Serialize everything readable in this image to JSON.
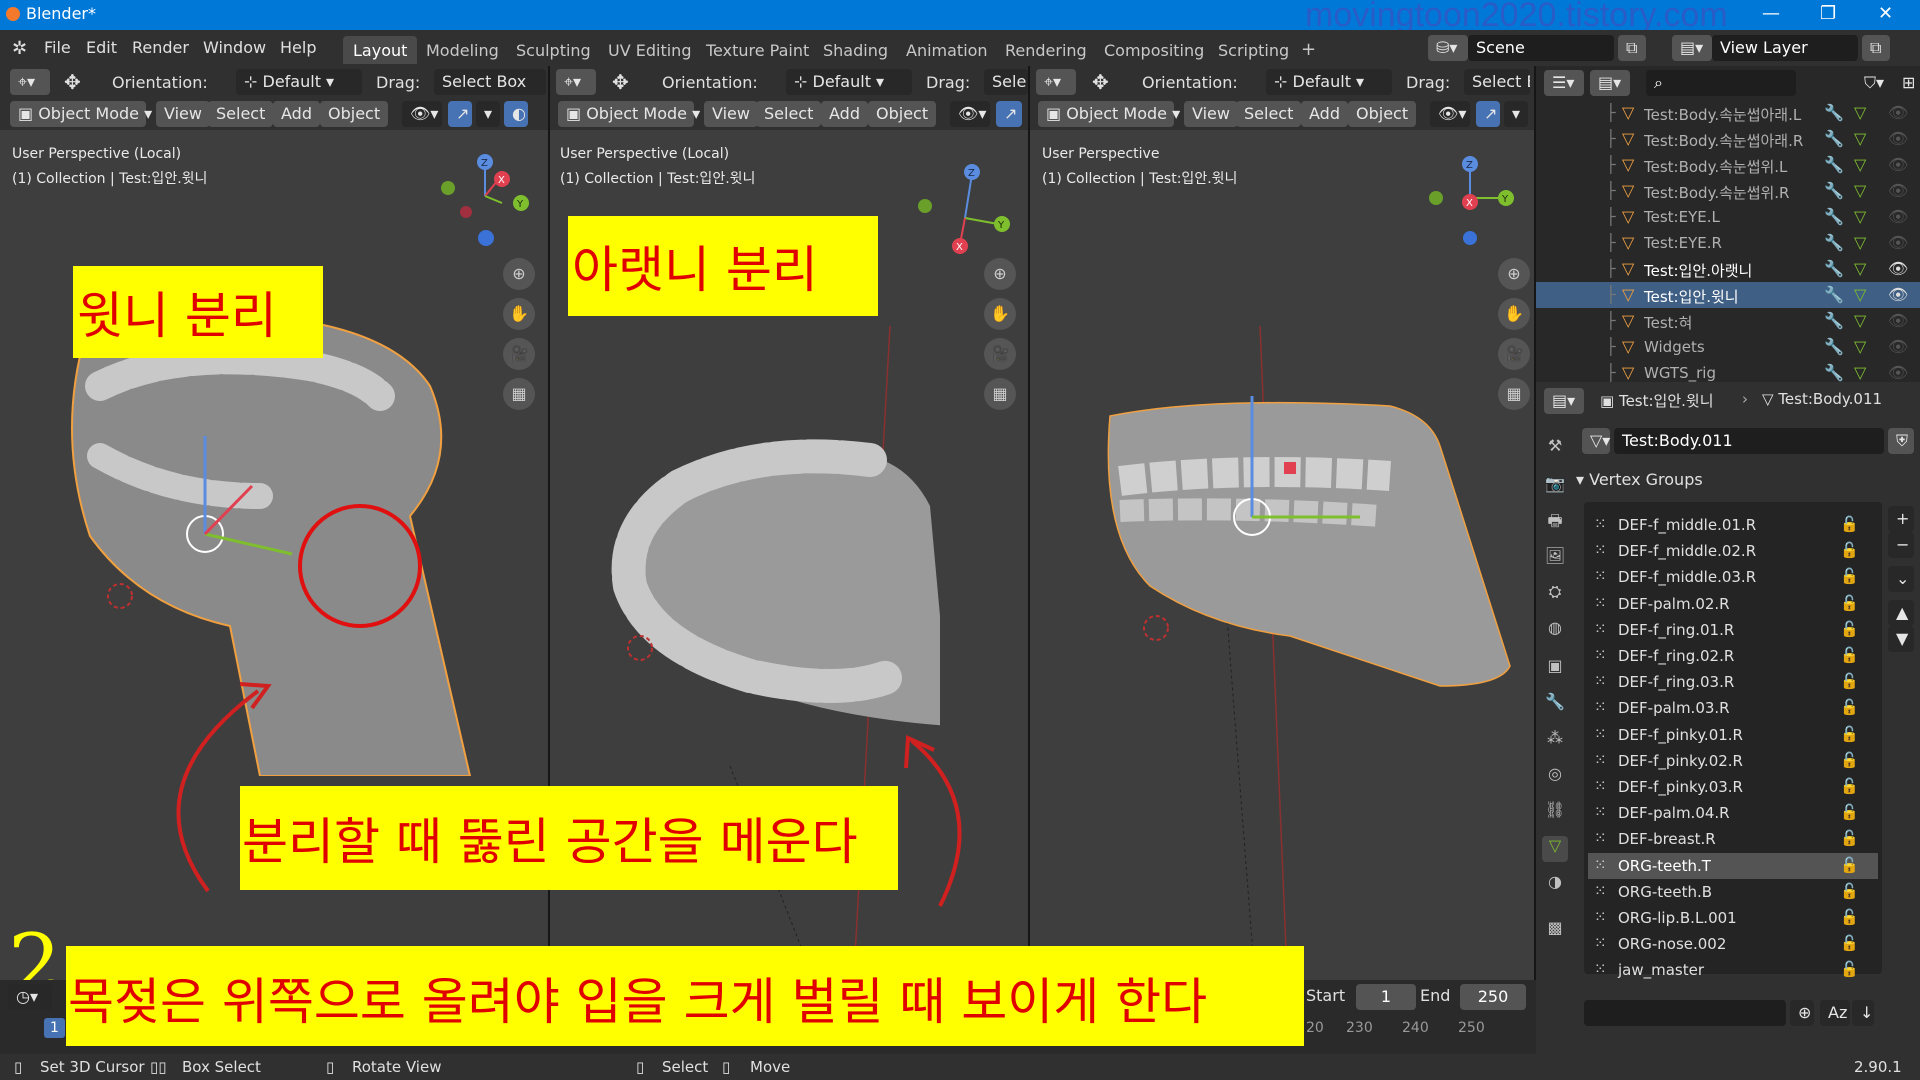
{
  "app": {
    "title": "Blender*",
    "watermark": "movingtoon2020.tistory.com",
    "version": "2.90.1"
  },
  "menus": [
    "File",
    "Edit",
    "Render",
    "Window",
    "Help"
  ],
  "workspace_tabs": [
    "Layout",
    "Modeling",
    "Sculpting",
    "UV Editing",
    "Texture Paint",
    "Shading",
    "Animation",
    "Rendering",
    "Compositing",
    "Scripting"
  ],
  "scene": {
    "name": "Scene",
    "view_layer": "View Layer"
  },
  "viewport_header": {
    "orientation_label": "Orientation:",
    "orientation_value": "Default",
    "drag_label": "Drag:",
    "drag_value": "Select Box",
    "drag_value_short": "Sele",
    "drag_value_short2": "Select E",
    "mode": "Object Mode",
    "view": "View",
    "select": "Select",
    "add": "Add",
    "object": "Object"
  },
  "viewports": [
    {
      "perspective": "User Perspective (Local)",
      "collection": "(1) Collection | Test:입안.윗니",
      "annotation": "윗니 분리"
    },
    {
      "perspective": "User Perspective (Local)",
      "collection": "(1) Collection | Test:입안.윗니",
      "annotation": "아랫니 분리"
    },
    {
      "perspective": "User Perspective",
      "collection": "(1) Collection | Test:입안.윗니"
    }
  ],
  "annotations": {
    "fill_gap": "분리할 때 뚫린 공간을 메운다",
    "uvula": "목젖은 위쪽으로 올려야 입을 크게 벌릴 때 보이게 한다",
    "step_number": "2"
  },
  "outliner": {
    "rows": [
      {
        "label": "Test:Body.속눈썹아래.L",
        "state": "dim"
      },
      {
        "label": "Test:Body.속눈썹아래.R",
        "state": "dim"
      },
      {
        "label": "Test:Body.속눈썹위.L",
        "state": "dim"
      },
      {
        "label": "Test:Body.속눈썹위.R",
        "state": "dim"
      },
      {
        "label": "Test:EYE.L",
        "state": "dim"
      },
      {
        "label": "Test:EYE.R",
        "state": "dim"
      },
      {
        "label": "Test:입안.아랫니",
        "state": "bright"
      },
      {
        "label": "Test:입안.윗니",
        "state": "selected"
      },
      {
        "label": "Test:혀",
        "state": "dim"
      },
      {
        "label": "Widgets",
        "state": "dim"
      },
      {
        "label": "WGTS_rig",
        "state": "dim"
      }
    ]
  },
  "properties": {
    "breadcrumb_object": "Test:입안.윗니",
    "breadcrumb_data": "Test:Body.011",
    "mesh_name": "Test:Body.011",
    "panel_title": "Vertex Groups",
    "vertex_groups": [
      "DEF-f_middle.01.R",
      "DEF-f_middle.02.R",
      "DEF-f_middle.03.R",
      "DEF-palm.02.R",
      "DEF-f_ring.01.R",
      "DEF-f_ring.02.R",
      "DEF-f_ring.03.R",
      "DEF-palm.03.R",
      "DEF-f_pinky.01.R",
      "DEF-f_pinky.02.R",
      "DEF-f_pinky.03.R",
      "DEF-palm.04.R",
      "DEF-breast.R",
      "ORG-teeth.T",
      "ORG-teeth.B",
      "ORG-lip.B.L.001",
      "ORG-nose.002",
      "jaw_master"
    ],
    "selected_group": "ORG-teeth.T",
    "sort_label": "Az"
  },
  "timeline": {
    "start_label": "Start",
    "start": "1",
    "end_label": "End",
    "end": "250",
    "frame": "1",
    "ticks": [
      "20",
      "230",
      "240",
      "250"
    ]
  },
  "statusbar": {
    "set_cursor": "Set 3D Cursor",
    "box_select": "Box Select",
    "rotate_view": "Rotate View",
    "select": "Select",
    "move": "Move"
  }
}
